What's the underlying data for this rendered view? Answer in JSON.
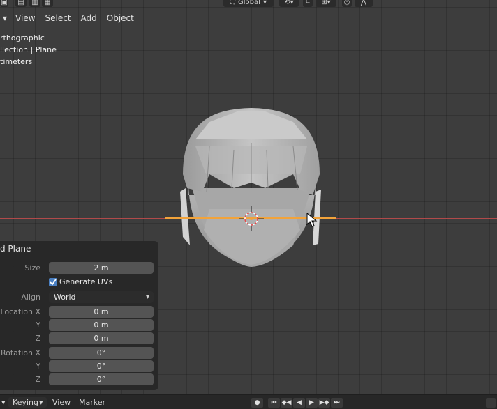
{
  "header": {
    "orientation": "Global",
    "menus": [
      "View",
      "Select",
      "Add",
      "Object"
    ]
  },
  "overlay": {
    "line1": "rthographic",
    "line2": "llection | Plane",
    "line3": "timeters"
  },
  "operator_panel": {
    "title": "d Plane",
    "size_label": "Size",
    "size_value": "2 m",
    "generate_uvs_label": "Generate UVs",
    "generate_uvs_checked": true,
    "align_label": "Align",
    "align_value": "World",
    "location_x_label": "Location X",
    "location_x": "0 m",
    "location_y_label": "Y",
    "location_y": "0 m",
    "location_z_label": "Z",
    "location_z": "0 m",
    "rotation_x_label": "Rotation X",
    "rotation_x": "0°",
    "rotation_y_label": "Y",
    "rotation_y": "0°",
    "rotation_z_label": "Z",
    "rotation_z": "0°"
  },
  "timeline": {
    "keying_label": "Keying",
    "view_label": "View",
    "marker_label": "Marker"
  },
  "colors": {
    "viewport_bg": "#3d3d3d",
    "x_axis": "#b14a4a",
    "z_axis": "#3b6fc0",
    "selected_plane": "#f2a33a",
    "checkbox": "#4a7fc1"
  }
}
